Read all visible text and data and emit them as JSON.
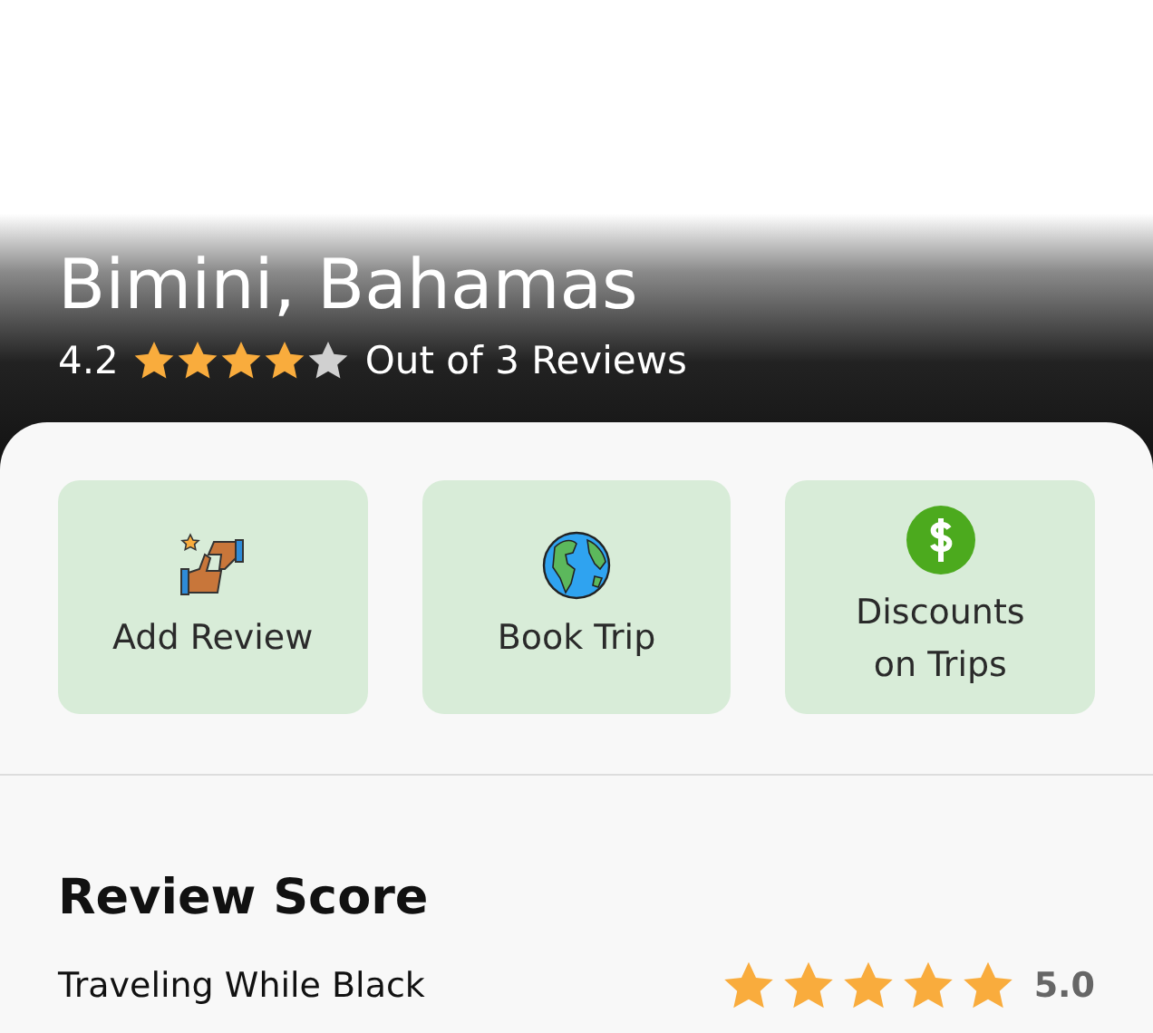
{
  "place": {
    "title": "Bimini, Bahamas",
    "rating": "4.2",
    "stars": 4,
    "reviews": "Out of 3 Reviews"
  },
  "actions": [
    {
      "kind": "review",
      "label": "Add Review"
    },
    {
      "kind": "globe",
      "label": "Book Trip"
    },
    {
      "kind": "dollar",
      "label": "Discounts on Trips"
    }
  ],
  "review_score": {
    "title": "Review Score",
    "rows": [
      {
        "label": "Traveling While Black",
        "stars": 5,
        "score": "5.0"
      }
    ]
  }
}
